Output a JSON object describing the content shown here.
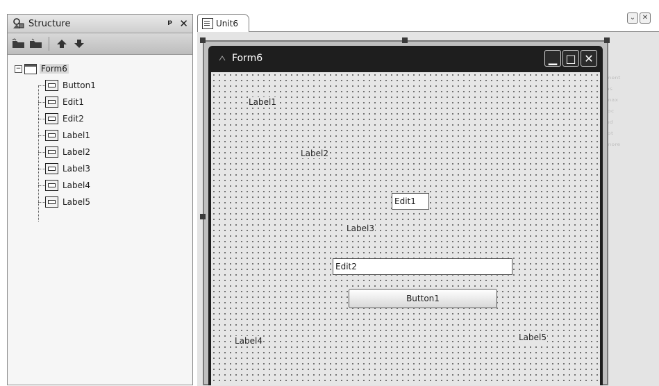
{
  "structure": {
    "title": "Structure",
    "pin_glyph": "ᵖ",
    "close_glyph": "✕",
    "toolbar_icons": [
      "folder-icon",
      "folder-up-icon",
      "arrow-up-icon",
      "arrow-down-icon"
    ],
    "root": "Form6",
    "children": [
      "Button1",
      "Edit1",
      "Edit2",
      "Label1",
      "Label2",
      "Label3",
      "Label4",
      "Label5"
    ]
  },
  "editor": {
    "tab_label": "Unit6",
    "ghost_lines": [
      "ᵐᵉⁿᵗ",
      "ᵃˢ",
      "ᵐᵃˣ",
      "ˡᵒᶜ",
      "ᵘᵈ",
      "ˡᵒᵗ",
      "ᵐᵒʳᵉ"
    ]
  },
  "form": {
    "title": "Form6",
    "minimize_glyph": "▁",
    "maximize_glyph": "□",
    "close_glyph": "✕",
    "label1": "Label1",
    "label2": "Label2",
    "label3": "Label3",
    "label4": "Label4",
    "label5": "Label5",
    "edit1": "Edit1",
    "edit2": "Edit2",
    "button1": "Button1"
  }
}
